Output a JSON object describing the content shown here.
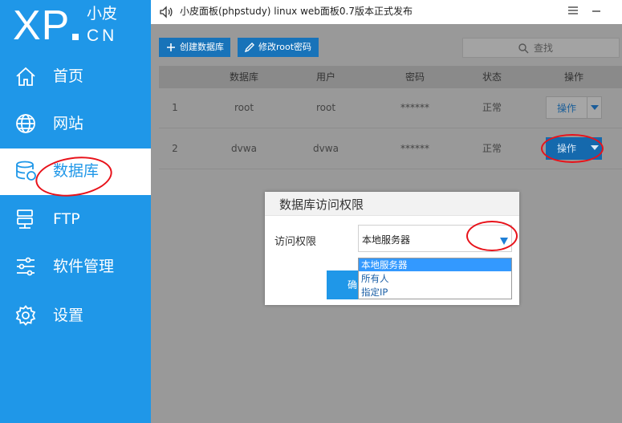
{
  "logo": {
    "brand": "XP",
    "cn_top": "小皮",
    "cn_bottom": "CN"
  },
  "sidebar": {
    "items": [
      {
        "label": "首页",
        "icon": "home-icon"
      },
      {
        "label": "网站",
        "icon": "globe-icon"
      },
      {
        "label": "数据库",
        "icon": "database-icon",
        "active": true
      },
      {
        "label": "FTP",
        "icon": "ftp-server-icon"
      },
      {
        "label": "软件管理",
        "icon": "sliders-icon"
      },
      {
        "label": "设置",
        "icon": "gear-icon"
      }
    ]
  },
  "titlebar": {
    "title": "小皮面板(phpstudy) linux web面板0.7版本正式发布",
    "icon": "speaker-icon"
  },
  "toolbar": {
    "create_label": "创建数据库",
    "edit_root_label": "修改root密码",
    "search_placeholder": "查找"
  },
  "table": {
    "headers": [
      "数据库",
      "用户",
      "密码",
      "状态",
      "操作"
    ],
    "rows": [
      {
        "index": "1",
        "database": "root",
        "user": "root",
        "password": "******",
        "status": "正常",
        "action": "操作"
      },
      {
        "index": "2",
        "database": "dvwa",
        "user": "dvwa",
        "password": "******",
        "status": "正常",
        "action": "操作"
      }
    ]
  },
  "dialog": {
    "title": "数据库访问权限",
    "field_label": "访问权限",
    "selected": "本地服务器",
    "options": [
      "本地服务器",
      "所有人",
      "指定IP"
    ],
    "ok_label": "确"
  },
  "colors": {
    "sidebar": "#1f97e8",
    "annotation": "#e8121a",
    "highlight": "#3399ff"
  }
}
